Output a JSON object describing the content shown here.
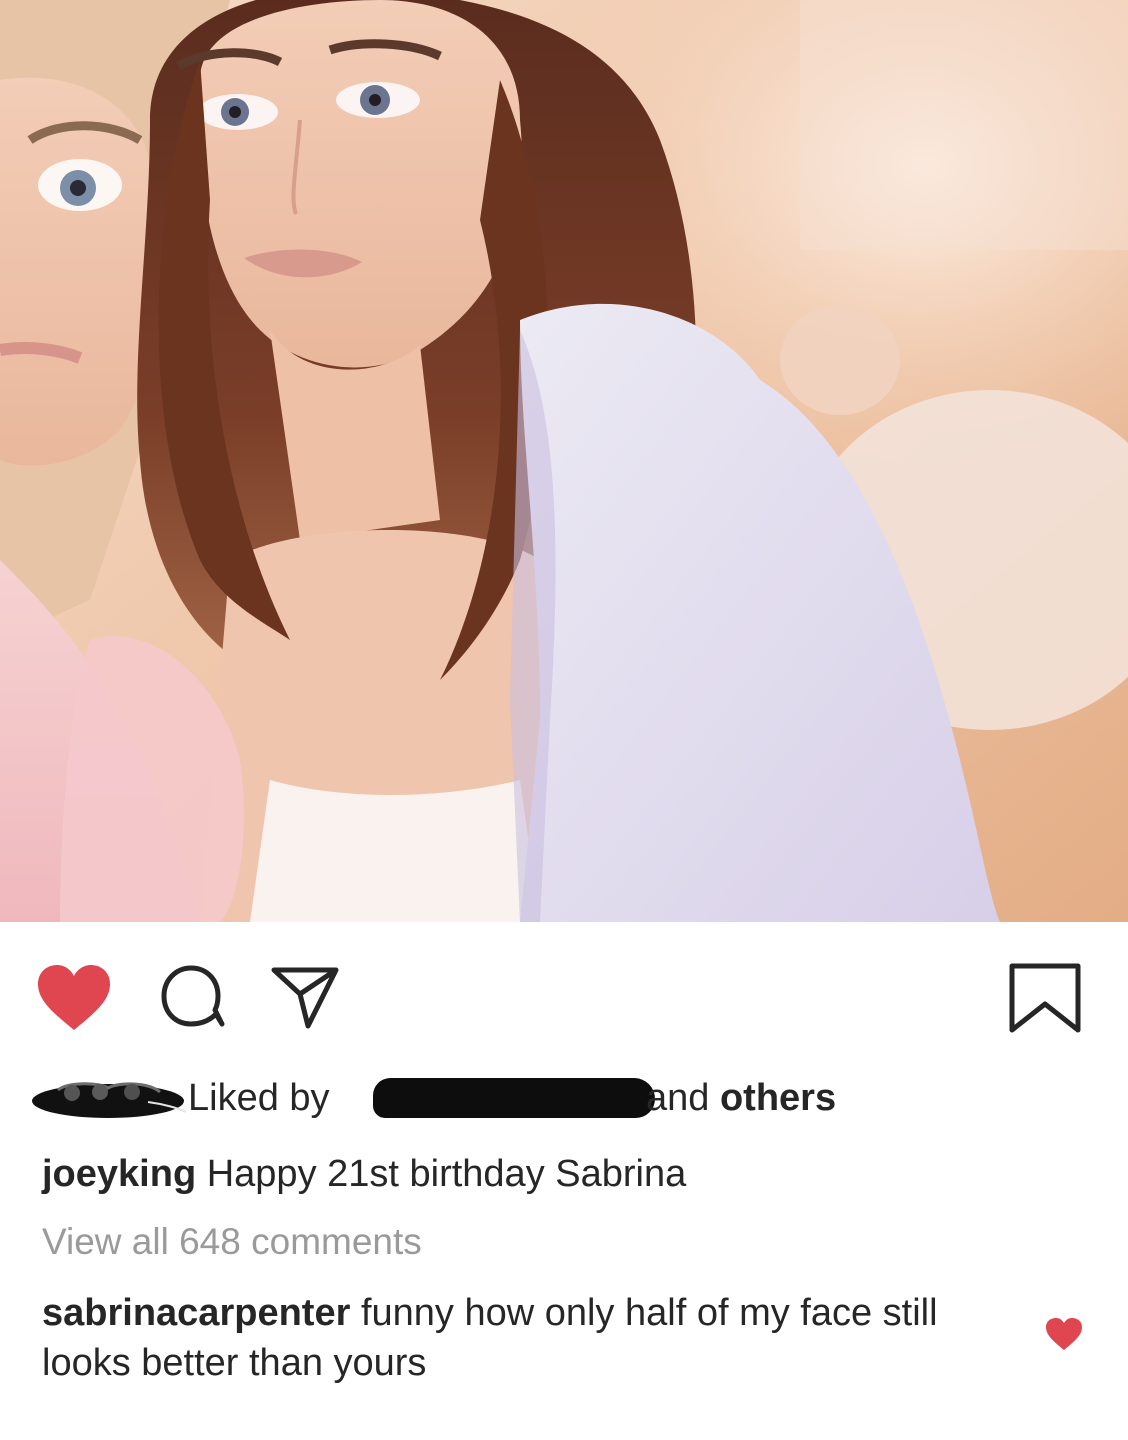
{
  "post": {
    "photo_alt": "photo",
    "actions": {
      "like_icon": "heart-filled-icon",
      "comment_icon": "comment-bubble-icon",
      "share_icon": "paper-plane-icon",
      "save_icon": "bookmark-icon",
      "like_color": "#e0464f"
    },
    "likes": {
      "prefix": "Liked by",
      "suffix": "and",
      "others": "others"
    },
    "caption": {
      "username": "joeyking",
      "text": "Happy 21st birthday Sabrina"
    },
    "view_all": "View all 648 comments",
    "comment": {
      "username": "sabrinacarpenter",
      "text": "funny how only half of my face still looks better than yours",
      "like_icon": "small-heart-icon"
    }
  }
}
